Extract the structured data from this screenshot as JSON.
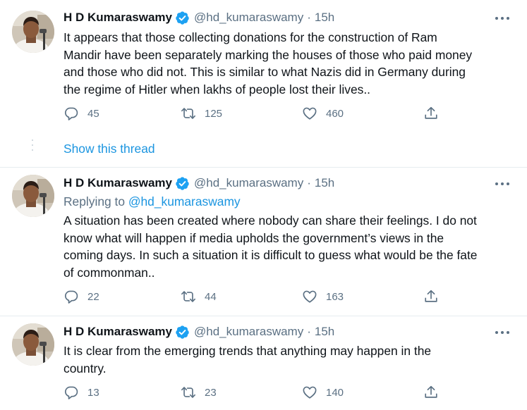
{
  "tweets": [
    {
      "name": "H D Kumaraswamy",
      "handle": "@hd_kumaraswamy",
      "separator": "·",
      "time": "15h",
      "reply_prefix": "",
      "reply_handle": "",
      "lines": [
        "It appears that those collecting donations for the construction of Ram",
        "Mandir have been separately marking the houses of those who paid money",
        "and those who did not. This is similar to what Nazis did in Germany during",
        "the regime of Hitler when lakhs of people lost their lives.."
      ],
      "replies": "45",
      "retweets": "125",
      "likes": "460"
    },
    {
      "name": "H D Kumaraswamy",
      "handle": "@hd_kumaraswamy",
      "separator": "·",
      "time": "15h",
      "reply_prefix": "Replying to",
      "reply_handle": "@hd_kumaraswamy",
      "lines": [
        "A situation has been created where nobody can share their feelings. I do not",
        "know what will happen if media upholds the government’s views in the",
        "coming days. In such a situation it is difficult to guess what would be the fate",
        "of commonman.."
      ],
      "replies": "22",
      "retweets": "44",
      "likes": "163"
    },
    {
      "name": "H D Kumaraswamy",
      "handle": "@hd_kumaraswamy",
      "separator": "·",
      "time": "15h",
      "reply_prefix": "",
      "reply_handle": "",
      "lines": [
        "It is clear from the emerging trends that anything may happen in the",
        "country."
      ],
      "replies": "13",
      "retweets": "23",
      "likes": "140"
    }
  ],
  "thread": {
    "show_label": "Show this thread"
  },
  "colors": {
    "link": "#1b95e0",
    "muted": "#5b7083",
    "verified": "#1da1f2",
    "text": "#0f1419"
  },
  "icons": [
    "more-icon",
    "verified-icon",
    "reply-icon",
    "retweet-icon",
    "like-icon",
    "share-icon"
  ]
}
